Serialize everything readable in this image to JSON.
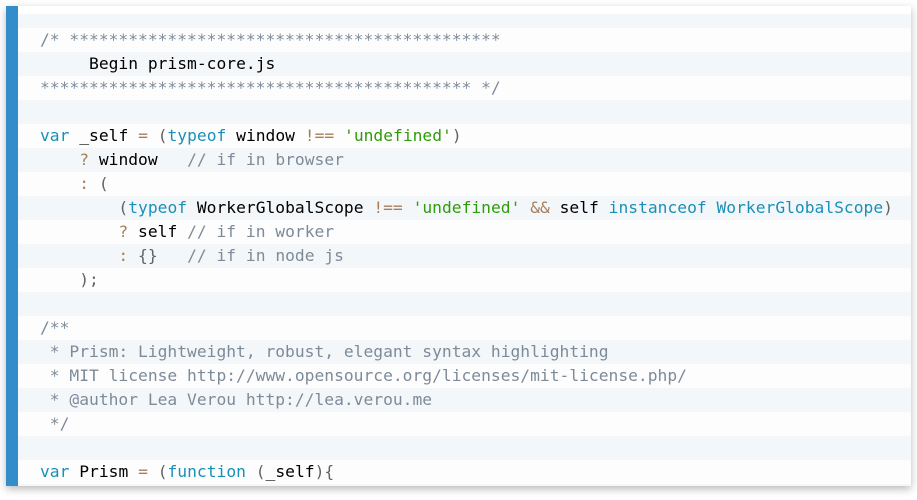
{
  "code_lines": [
    "/* ********************************************",
    "     Begin prism-core.js",
    "******************************************** */",
    "",
    "var _self = (typeof window !== 'undefined')",
    "    ? window   // if in browser",
    "    : (",
    "        (typeof WorkerGlobalScope !== 'undefined' && self instanceof WorkerGlobalScope)",
    "        ? self // if in worker",
    "        : {}   // if in node js",
    "    );",
    "",
    "/**",
    " * Prism: Lightweight, robust, elegant syntax highlighting",
    " * MIT license http://www.opensource.org/licenses/mit-license.php/",
    " * @author Lea Verou http://lea.verou.me",
    " */",
    "",
    "var Prism = (function (_self){"
  ],
  "colors": {
    "accent_bar": "#358ccb",
    "comment": "#7d8b99",
    "keyword": "#1990b8",
    "string": "#2f9c0a",
    "operator": "#a67f59"
  }
}
